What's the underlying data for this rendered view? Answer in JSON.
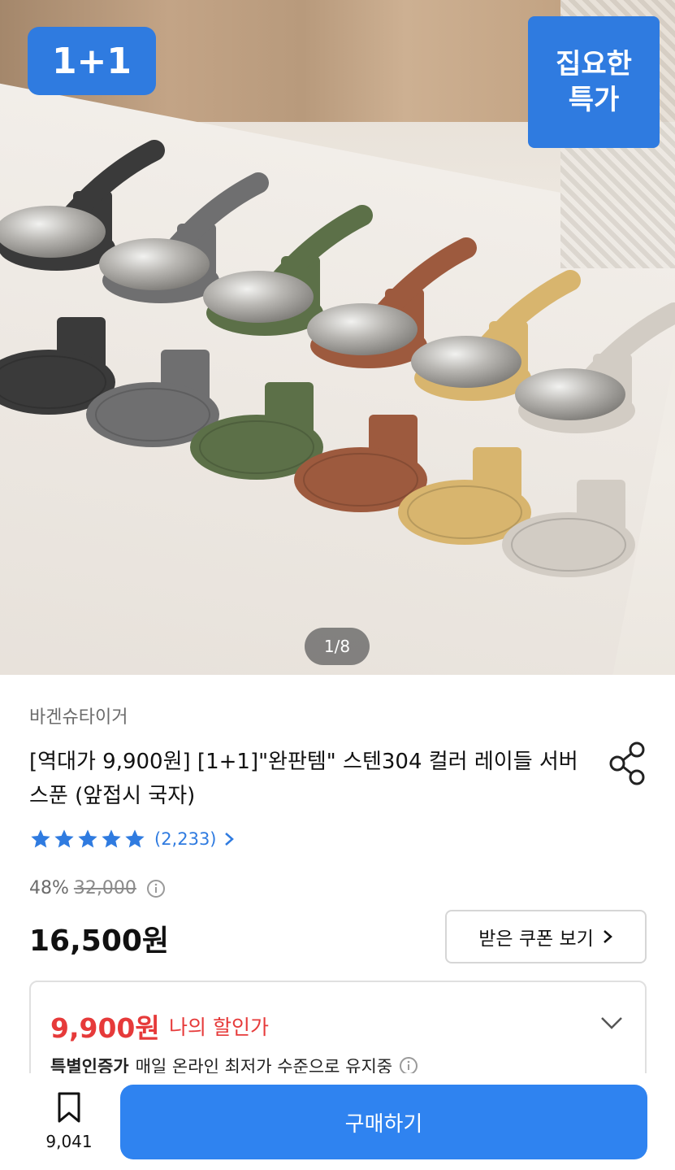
{
  "hero": {
    "badge_left": "1+1",
    "badge_right_line1": "집요한",
    "badge_right_line2": "특가",
    "pager": "1/8",
    "spoon_colors": [
      "#3a3a3a",
      "#6f6f70",
      "#5c7048",
      "#9d5a3e",
      "#d8b56e",
      "#d2ccc4"
    ]
  },
  "product": {
    "brand": "바겐슈타이거",
    "title": "[역대가 9,900원] [1+1]\"완판템\" 스텐304 컬러 레이들 서버스푼 (앞접시 국자)",
    "rating_stars": 5,
    "review_count": "(2,233)",
    "discount_percent": "48%",
    "original_price": "32,000",
    "price": "16,500원",
    "coupon_button": "받은 쿠폰 보기"
  },
  "deal": {
    "price": "9,900원",
    "label": "나의 할인가",
    "badge": "특별인증가",
    "note": "매일 온라인 최저가 수준으로 유지중"
  },
  "bottom": {
    "bookmark_count": "9,041",
    "buy_button": "구매하기"
  },
  "colors": {
    "accent": "#2f7be0",
    "deal_red": "#e63a3a",
    "buy_button": "#2f83f0"
  }
}
